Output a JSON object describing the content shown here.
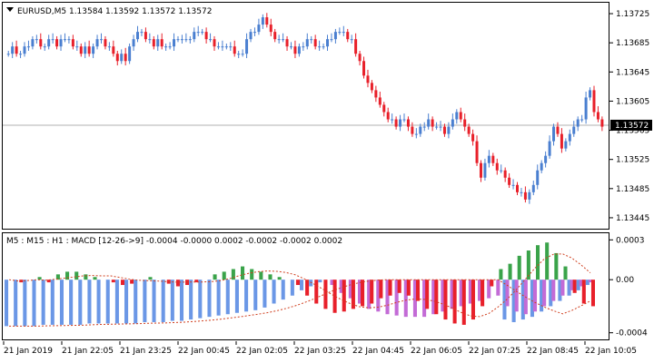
{
  "main_chart": {
    "symbol_info": "EURUSD,M5  1.13584 1.13592 1.13572 1.13572",
    "current_price_label": "1.13572",
    "price_axis_labels": [
      "1.13725",
      "1.13685",
      "1.13645",
      "1.13605",
      "1.13565",
      "1.13525",
      "1.13485",
      "1.13445"
    ],
    "colors": {
      "bull": "#4a7fd0",
      "bear": "#e8202a",
      "current_line": "#b0b0b0"
    }
  },
  "indicator": {
    "header": "M5 : M15 : H1 :  MACD [12-26->9] -0.0004 -0.0000 0.0002 -0.0002 -0.0002 0.0002",
    "axis_labels": [
      "0.0003",
      "0.00",
      "-0.0004"
    ],
    "colors": {
      "m5_pos": "#3aa34a",
      "m5_neg": "#e8202a",
      "m15": "#c36bd6",
      "h1": "#6b97e6",
      "signal": "#d04020"
    }
  },
  "time_axis_labels": [
    "21 Jan 2019",
    "21 Jan 22:05",
    "21 Jan 23:25",
    "22 Jan 00:45",
    "22 Jan 02:05",
    "22 Jan 03:25",
    "22 Jan 04:45",
    "22 Jan 06:05",
    "22 Jan 07:25",
    "22 Jan 08:45",
    "22 Jan 10:05"
  ],
  "chart_data": [
    {
      "type": "candlestick",
      "title": "EURUSD,M5  1.13584 1.13592 1.13572 1.13572",
      "y_range": [
        1.1343,
        1.1374
      ],
      "y_ticks": [
        1.13725,
        1.13685,
        1.13645,
        1.13605,
        1.13565,
        1.13525,
        1.13485,
        1.13445
      ],
      "x_tick_labels": [
        "21 Jan 2019",
        "21 Jan 22:05",
        "21 Jan 23:25",
        "22 Jan 00:45",
        "22 Jan 02:05",
        "22 Jan 03:25",
        "22 Jan 04:45",
        "22 Jan 06:05",
        "22 Jan 07:25",
        "22 Jan 08:45",
        "22 Jan 10:05"
      ],
      "close_path": [
        1.1367,
        1.1368,
        1.1367,
        1.1367,
        1.1368,
        1.1368,
        1.1369,
        1.1369,
        1.1368,
        1.1368,
        1.1369,
        1.1369,
        1.1368,
        1.1369,
        1.1369,
        1.1369,
        1.1368,
        1.1368,
        1.1367,
        1.1368,
        1.1367,
        1.1368,
        1.1369,
        1.1369,
        1.1368,
        1.1368,
        1.1367,
        1.1366,
        1.1367,
        1.1366,
        1.1368,
        1.1369,
        1.137,
        1.137,
        1.1369,
        1.1369,
        1.1368,
        1.1369,
        1.1368,
        1.1368,
        1.1368,
        1.1369,
        1.1369,
        1.1369,
        1.1369,
        1.1369,
        1.137,
        1.137,
        1.137,
        1.1369,
        1.1369,
        1.1368,
        1.1368,
        1.1368,
        1.1368,
        1.1368,
        1.1367,
        1.1367,
        1.1367,
        1.1369,
        1.137,
        1.137,
        1.1371,
        1.1372,
        1.1371,
        1.137,
        1.1369,
        1.1369,
        1.1369,
        1.1368,
        1.1368,
        1.1367,
        1.1368,
        1.1368,
        1.1369,
        1.1369,
        1.1368,
        1.1368,
        1.1368,
        1.1369,
        1.1369,
        1.137,
        1.137,
        1.137,
        1.1369,
        1.1369,
        1.1367,
        1.1366,
        1.1364,
        1.1363,
        1.1362,
        1.1361,
        1.136,
        1.1359,
        1.1358,
        1.1358,
        1.1357,
        1.1358,
        1.1358,
        1.1357,
        1.1356,
        1.1356,
        1.1357,
        1.1357,
        1.1358,
        1.1357,
        1.1357,
        1.1357,
        1.1356,
        1.1357,
        1.1358,
        1.1359,
        1.1358,
        1.1357,
        1.1356,
        1.1355,
        1.1352,
        1.135,
        1.1352,
        1.1353,
        1.1352,
        1.1351,
        1.1351,
        1.135,
        1.1349,
        1.1349,
        1.1348,
        1.1348,
        1.1347,
        1.1348,
        1.1349,
        1.1351,
        1.1352,
        1.1353,
        1.1355,
        1.1357,
        1.1356,
        1.1354,
        1.1355,
        1.1356,
        1.1357,
        1.1358,
        1.1358,
        1.1361,
        1.1362,
        1.1359,
        1.1358,
        1.1357
      ],
      "current_price": 1.13572
    },
    {
      "type": "bar",
      "title": "M5 : M15 : H1 :  MACD [12-26->9] -0.0004 -0.0000 0.0002 -0.0002 -0.0002 0.0002",
      "y_range": [
        -0.00045,
        0.00035
      ],
      "y_ticks": [
        0.0003,
        0.0,
        -0.0004
      ],
      "series": [
        {
          "name": "M5",
          "values": [
            0.0,
            -2e-05,
            0.0,
            2e-05,
            -2e-05,
            4e-05,
            6e-05,
            6e-05,
            4e-05,
            2e-05,
            0.0,
            -2e-05,
            -4e-05,
            -3e-05,
            0.0,
            2e-05,
            0.0,
            -3e-05,
            -5e-05,
            -4e-05,
            -2e-05,
            0.0,
            4e-05,
            6e-05,
            8e-05,
            0.0001,
            8e-05,
            6e-05,
            4e-05,
            2e-05,
            0.0,
            -4e-05,
            -0.00012,
            -0.00018,
            -0.00022,
            -0.00025,
            -0.00024,
            -0.00022,
            -0.0002,
            -0.00018,
            -0.00014,
            -0.00012,
            -0.0001,
            -0.00012,
            -0.00016,
            -0.00022,
            -0.00026,
            -0.0003,
            -0.00033,
            -0.00034,
            -0.0003,
            -0.0002,
            -5e-05,
            8e-05,
            0.00012,
            0.00018,
            0.00022,
            0.00026,
            0.00028,
            0.0002,
            0.0001,
            -0.0001,
            -0.00018,
            -0.0002
          ]
        },
        {
          "name": "M15",
          "values": [
            0.0,
            0.0,
            0.0,
            0.0,
            0.0,
            0.0,
            0.0,
            0.0,
            0.0,
            0.0,
            0.0,
            0.0,
            0.0,
            0.0,
            0.0,
            0.0,
            0.0,
            0.0,
            0.0,
            0.0,
            0.0,
            0.0,
            0.0,
            0.0,
            0.0,
            0.0,
            0.0,
            0.0,
            0.0,
            0.0,
            0.0,
            0.0,
            0.0,
            0.0,
            0.0,
            -4e-05,
            -0.0001,
            -0.00014,
            -0.00018,
            -0.00022,
            -0.00024,
            -0.00026,
            -0.00027,
            -0.00028,
            -0.00028,
            -0.00028,
            -0.00026,
            -0.00024,
            -0.00022,
            -0.0002,
            -0.00018,
            -0.00016,
            -0.00014,
            -0.00012,
            -0.0002,
            -0.00024,
            -0.00026,
            -0.00024,
            -0.0002,
            -0.00016,
            -0.00012,
            -8e-05,
            -5e-05,
            -2e-05
          ]
        },
        {
          "name": "H1",
          "values": [
            -0.00035,
            -0.00035,
            -0.00035,
            -0.00035,
            -0.00034,
            -0.00034,
            -0.00034,
            -0.00034,
            -0.00034,
            -0.00033,
            -0.00033,
            -0.00033,
            -0.00033,
            -0.00033,
            -0.00033,
            -0.00032,
            -0.00032,
            -0.00032,
            -0.00031,
            -0.00031,
            -0.0003,
            -0.00029,
            -0.00028,
            -0.00027,
            -0.00026,
            -0.00025,
            -0.00024,
            -0.00023,
            -0.00021,
            -0.00018,
            -0.00015,
            -0.00012,
            -8e-05,
            -5e-05,
            -2e-05,
            0.0,
            0.0,
            0.0,
            0.0,
            0.0,
            0.0,
            0.0,
            0.0,
            0.0,
            0.0,
            0.0,
            0.0,
            0.0,
            0.0,
            0.0,
            0.0,
            0.0,
            0.0,
            0.0,
            -0.0003,
            -0.00032,
            -0.0003,
            -0.00028,
            -0.00024,
            -0.0002,
            -0.00016,
            -0.00012,
            -8e-05,
            -4e-05
          ]
        }
      ]
    }
  ]
}
